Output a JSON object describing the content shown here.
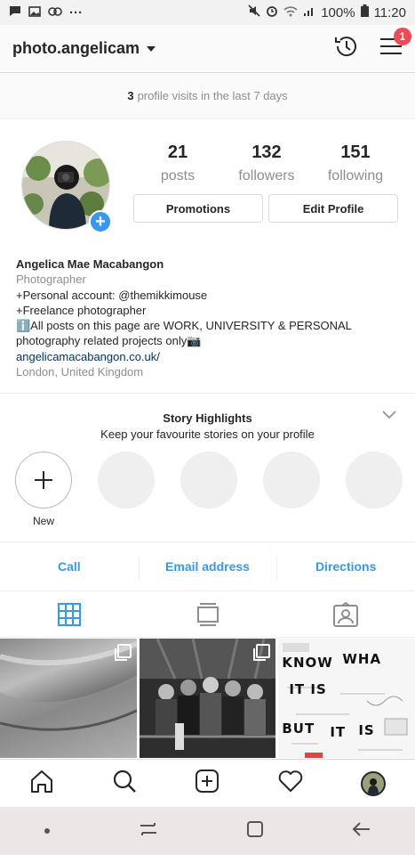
{
  "status_bar": {
    "battery": "100%",
    "time": "11:20",
    "dots": "···"
  },
  "header": {
    "username": "photo.angelicam",
    "notification_count": "1"
  },
  "visits": {
    "count": "3",
    "text": "profile visits in the last 7 days"
  },
  "profile": {
    "stats": [
      {
        "value": "21",
        "label": "posts"
      },
      {
        "value": "132",
        "label": "followers"
      },
      {
        "value": "151",
        "label": "following"
      }
    ],
    "buttons": {
      "promotions": "Promotions",
      "edit_profile": "Edit Profile"
    },
    "bio": {
      "name": "Angelica Mae Macabangon",
      "category": "Photographer",
      "line1": "+Personal account: @themikkimouse",
      "line2": "+Freelance photographer",
      "line3": "ℹ️All posts on this page are WORK, UNIVERSITY & PERSONAL photography related projects only📷",
      "website": "angelicamacabangon.co.uk/",
      "location": "London, United Kingdom"
    }
  },
  "highlights": {
    "title": "Story Highlights",
    "subtitle": "Keep your favourite stories on your profile",
    "new_label": "New"
  },
  "actions": {
    "call": "Call",
    "email": "Email address",
    "directions": "Directions"
  },
  "grid": {
    "sketch_words": [
      "KNOW",
      "WHA",
      "IT IS",
      "BUT",
      "IT",
      "IS"
    ]
  },
  "colors": {
    "accent": "#3897f0",
    "badge": "#ed4956",
    "text": "#262626",
    "muted": "#8e8e8e",
    "link": "#003569"
  }
}
